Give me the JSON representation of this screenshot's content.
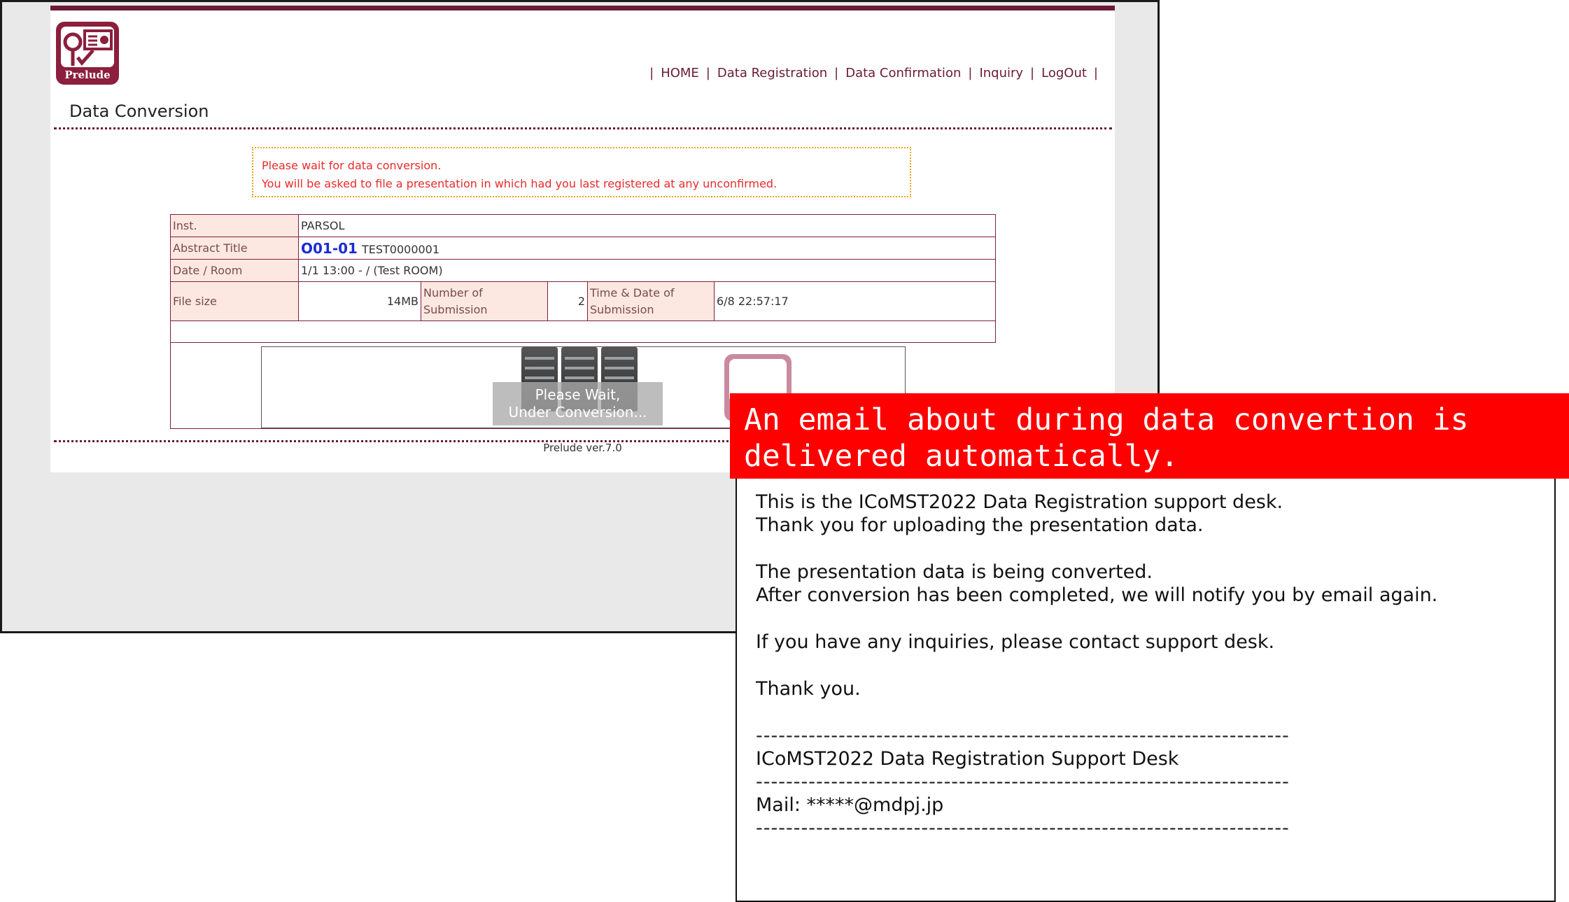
{
  "logo": {
    "word": "Prelude"
  },
  "nav": {
    "home": "HOME",
    "data_registration": "Data Registration",
    "data_confirmation": "Data Confirmation",
    "inquiry": "Inquiry",
    "logout": "LogOut",
    "separator": "|"
  },
  "page_title": "Data Conversion",
  "notice": {
    "line1": "Please wait for data conversion.",
    "line2": "You will be asked to file a presentation in which had you last registered at any unconfirmed."
  },
  "info": {
    "inst_label": "Inst.",
    "inst_value": "PARSOL",
    "abstract_label": "Abstract Title",
    "abstract_code": "O01-01",
    "abstract_value": "TEST0000001",
    "date_label": "Date / Room",
    "date_value": "1/1 13:00 - / (Test ROOM)",
    "filesize_label": "File size",
    "filesize_value": "14MB",
    "numsub_label": "Number of Submission",
    "numsub_value": "2",
    "timesub_label": "Time & Date of Submission",
    "timesub_value": "6/8 22:57:17"
  },
  "conversion": {
    "wait_line1": "Please Wait,",
    "wait_line2": "Under Conversion..."
  },
  "version": "Prelude ver.7.0",
  "callout": "An email about during data convertion is delivered automatically.",
  "email": {
    "l1": "This is the ICoMST2022 Data Registration support desk.",
    "l2": "Thank you for uploading the presentation data.",
    "l3": "The presentation data is being converted.",
    "l4": "After conversion has been completed, we will notify you by email again.",
    "l5": "If you have any inquiries, please contact support desk.",
    "l6": "Thank you.",
    "dash": "-----------------------------------------------------------------------",
    "desk": "ICoMST2022 Data Registration Support Desk",
    "mail": "Mail: *****@mdpj.jp"
  },
  "colors": {
    "brand": "#6b1a35",
    "notice_text": "#e82b2b",
    "notice_border": "#f2a21a",
    "label_bg": "#fde8e1",
    "callout_bg": "#fe0000",
    "code": "#1d2bd6"
  }
}
